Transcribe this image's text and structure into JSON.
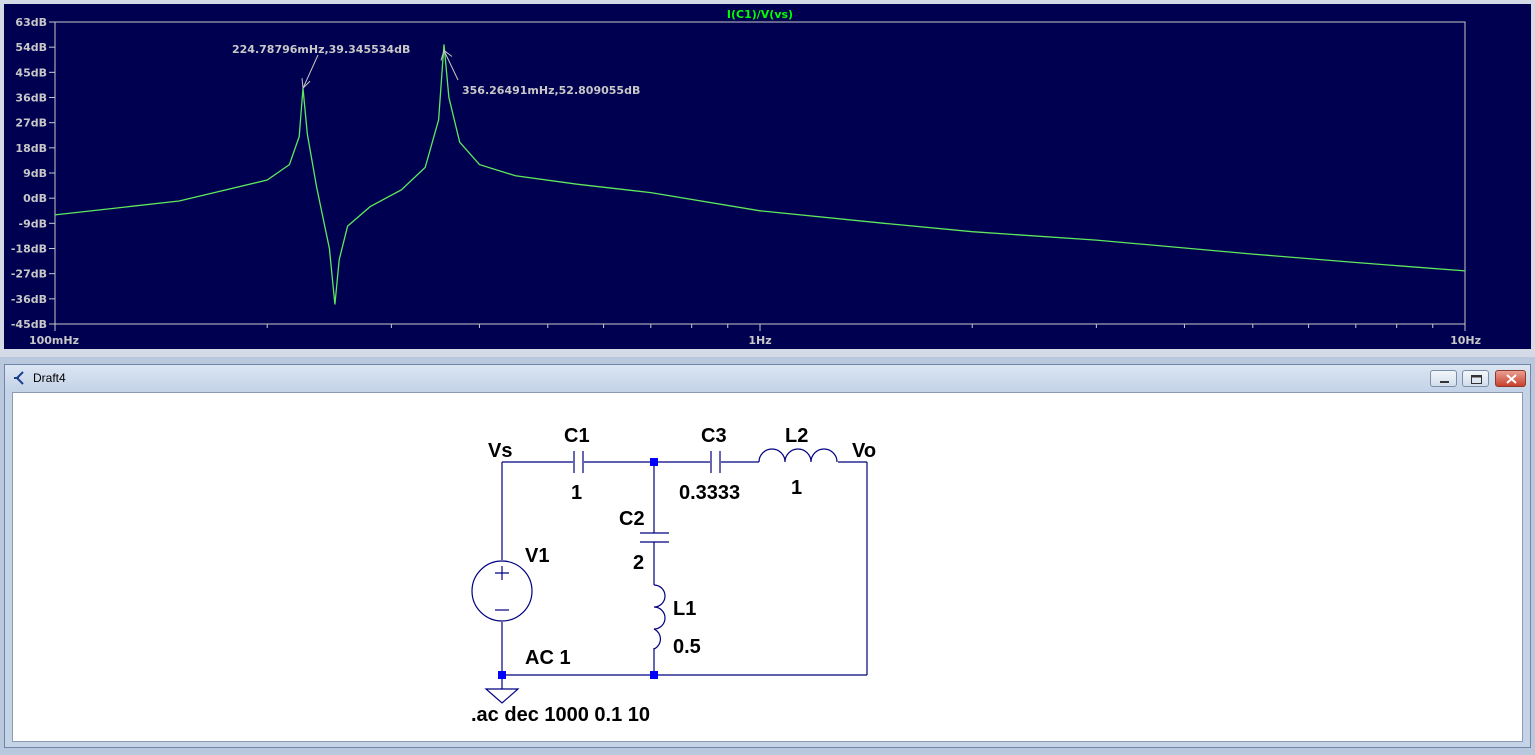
{
  "plot": {
    "trace_title": "I(C1)/V(vs)",
    "colors": {
      "background": "#000050",
      "trace": "#5de85d",
      "grid_text": "#c8c8c8",
      "title": "#00ff00"
    },
    "annotations": [
      {
        "text": "224.78796mHz,39.345534dB"
      },
      {
        "text": "356.26491mHz,52.809055dB"
      }
    ]
  },
  "chart_data": {
    "type": "line",
    "x_scale": "log",
    "xlim": [
      0.1,
      10
    ],
    "ylim": [
      -45,
      63
    ],
    "y_ticks": [
      "63dB",
      "54dB",
      "45dB",
      "36dB",
      "27dB",
      "18dB",
      "9dB",
      "0dB",
      "-9dB",
      "-18dB",
      "-27dB",
      "-36dB",
      "-45dB"
    ],
    "x_ticks": [
      "100mHz",
      "1Hz",
      "10Hz"
    ],
    "series": [
      {
        "name": "I(C1)/V(vs)",
        "x": [
          0.1,
          0.15,
          0.2,
          0.215,
          0.222,
          0.2248,
          0.228,
          0.235,
          0.245,
          0.2495,
          0.253,
          0.26,
          0.28,
          0.31,
          0.335,
          0.35,
          0.3563,
          0.362,
          0.375,
          0.4,
          0.45,
          0.55,
          0.7,
          1.0,
          1.5,
          2,
          3,
          5,
          7,
          10
        ],
        "y": [
          -6,
          -1,
          6.5,
          12,
          22,
          39.3,
          23,
          4,
          -18,
          -38,
          -22,
          -10,
          -3,
          3,
          11,
          28,
          55,
          36,
          20,
          12,
          8,
          5,
          2,
          -4.5,
          -9,
          -12,
          -15,
          -20,
          -23,
          -26
        ]
      }
    ],
    "markers": [
      {
        "x": 0.22478796,
        "y": 39.345534
      },
      {
        "x": 0.35626491,
        "y": 52.809055
      }
    ]
  },
  "schematic_window": {
    "title": "Draft4",
    "buttons": {
      "minimize": "minimize",
      "maximize": "maximize",
      "close": "close"
    },
    "labels": {
      "vs": "Vs",
      "vo": "Vo",
      "c1_name": "C1",
      "c1_value": "1",
      "c3_name": "C3",
      "c3_value": "0.3333",
      "l2_name": "L2",
      "l2_value": "1",
      "c2_name": "C2",
      "c2_value": "2",
      "l1_name": "L1",
      "l1_value": "0.5",
      "v1_name": "V1",
      "v1_value": "AC 1",
      "directive": ".ac dec 1000 0.1 10"
    },
    "colors": {
      "wire": "#000080",
      "node": "#0000ff",
      "label": "#000000"
    }
  }
}
